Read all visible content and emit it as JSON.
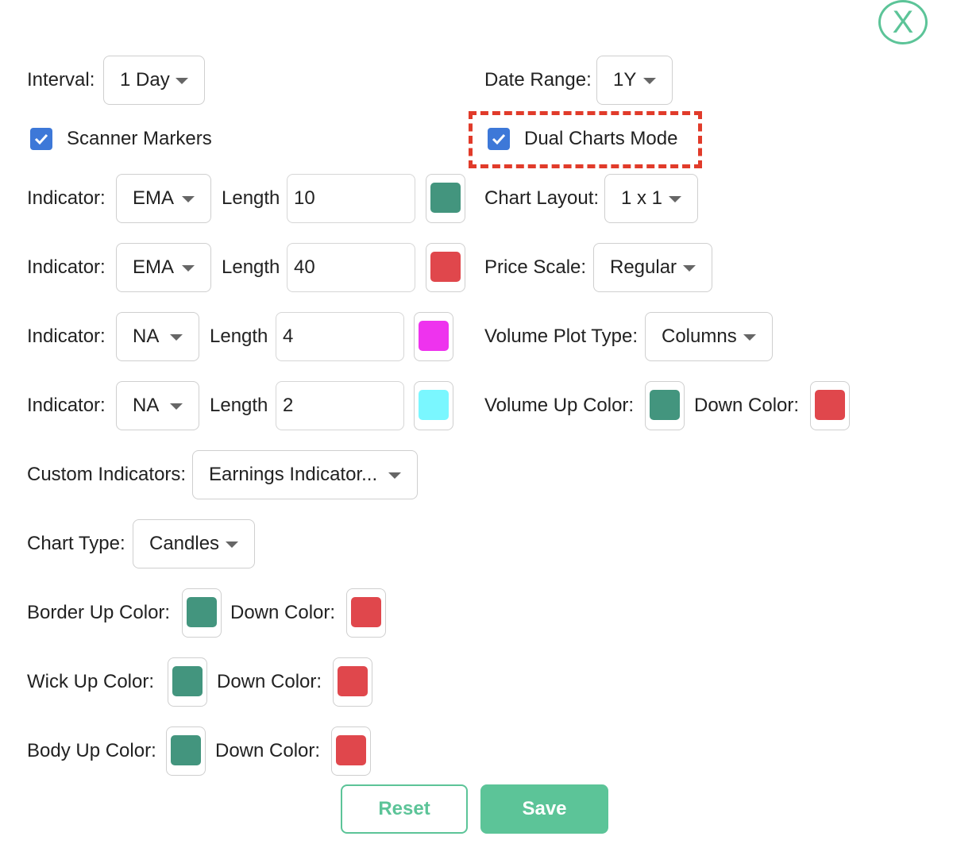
{
  "close_label": "X",
  "interval": {
    "label": "Interval:",
    "value": "1 Day"
  },
  "date_range": {
    "label": "Date Range:",
    "value": "1Y"
  },
  "scanner_markers": {
    "label": "Scanner Markers",
    "checked": true
  },
  "dual_charts": {
    "label": "Dual Charts Mode",
    "checked": true
  },
  "indicators": [
    {
      "label": "Indicator:",
      "type": "EMA",
      "length_label": "Length",
      "length": "10",
      "color": "#43957e"
    },
    {
      "label": "Indicator:",
      "type": "EMA",
      "length_label": "Length",
      "length": "40",
      "color": "#e0474c"
    },
    {
      "label": "Indicator:",
      "type": "NA",
      "length_label": "Length",
      "length": "4",
      "color": "#ee33ee"
    },
    {
      "label": "Indicator:",
      "type": "NA",
      "length_label": "Length",
      "length": "2",
      "color": "#7af7ff"
    }
  ],
  "chart_layout": {
    "label": "Chart Layout:",
    "value": "1 x 1"
  },
  "price_scale": {
    "label": "Price Scale:",
    "value": "Regular"
  },
  "volume_plot_type": {
    "label": "Volume Plot Type:",
    "value": "Columns"
  },
  "volume_colors": {
    "label": "Volume Up Color:",
    "down_label": "Down Color:",
    "up": "#43957e",
    "down": "#e0474c"
  },
  "custom_indicators": {
    "label": "Custom Indicators:",
    "value": "Earnings Indicator..."
  },
  "chart_type": {
    "label": "Chart Type:",
    "value": "Candles"
  },
  "border_colors": {
    "label": "Border Up Color:",
    "down_label": "Down Color:",
    "up": "#43957e",
    "down": "#e0474c"
  },
  "wick_colors": {
    "label": "Wick Up Color:",
    "down_label": "Down Color:",
    "up": "#43957e",
    "down": "#e0474c"
  },
  "body_colors": {
    "label": "Body Up Color:",
    "down_label": "Down Color:",
    "up": "#43957e",
    "down": "#e0474c"
  },
  "buttons": {
    "reset": "Reset",
    "save": "Save"
  },
  "theme": {
    "accent": "#5cc498",
    "checkbox": "#3d78d8",
    "highlight": "#e13b2a"
  }
}
